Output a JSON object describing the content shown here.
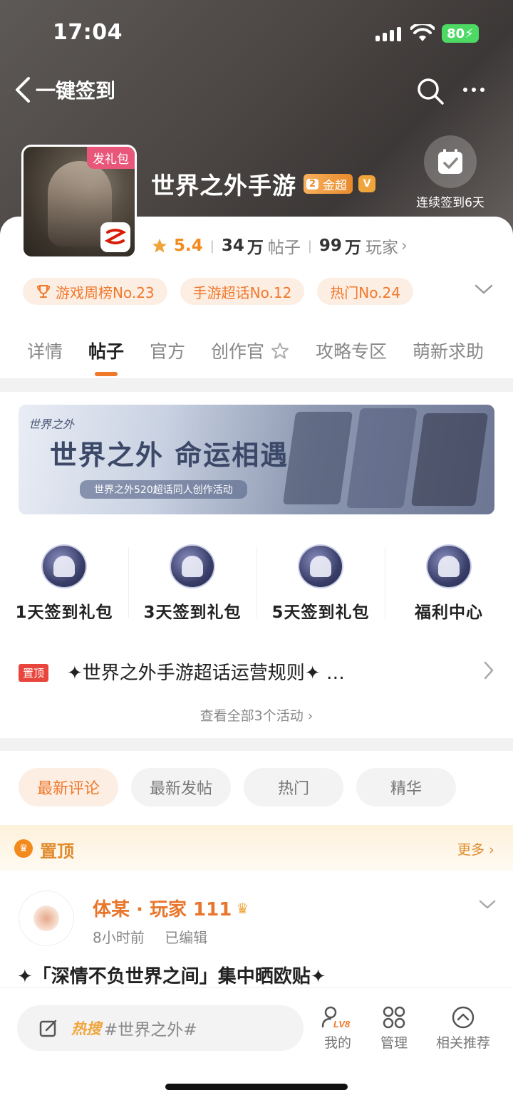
{
  "status": {
    "time": "17:04",
    "battery": "80"
  },
  "nav": {
    "title": "一键签到"
  },
  "game": {
    "cover_tag": "发礼包",
    "title": "世界之外手游",
    "badge": "金超",
    "badge_level": "2",
    "rating": "5.4",
    "posts_num": "34",
    "posts_unit": "万",
    "posts_label": "帖子",
    "players_num": "99",
    "players_unit": "万",
    "players_label": "玩家"
  },
  "checkin": {
    "label": "连续签到6天"
  },
  "ranks": [
    "游戏周榜No.23",
    "手游超话No.12",
    "热门No.24"
  ],
  "tabs": [
    "详情",
    "帖子",
    "官方",
    "创作官",
    "攻略专区",
    "萌新求助"
  ],
  "banner": {
    "small": "世界之外",
    "title": "世界之外 命运相遇",
    "subtitle": "世界之外520超话同人创作活动"
  },
  "gifts": [
    "1天签到礼包",
    "3天签到礼包",
    "5天签到礼包",
    "福利中心"
  ],
  "pinned_rule": {
    "tag": "置顶",
    "text": "✦世界之外手游超话运营规则✦ …"
  },
  "view_all": "查看全部3个活动",
  "filters": [
    "最新评论",
    "最新发帖",
    "热门",
    "精华"
  ],
  "pin_section": {
    "label": "置顶",
    "more": "更多"
  },
  "post": {
    "author": "体某 · 玩家 111",
    "time": "8小时前",
    "edited": "已编辑",
    "title": "✦「深情不负世界之间」集中晒欧贴✦"
  },
  "bottom": {
    "hot": "热搜",
    "topic": "#世界之外#",
    "mine": "我的",
    "mine_level": "LV8",
    "manage": "管理",
    "recommend": "相关推荐"
  },
  "colors": {
    "accent": "#f0782a",
    "gold": "#f0a53c",
    "pin_red": "#e8453c"
  }
}
